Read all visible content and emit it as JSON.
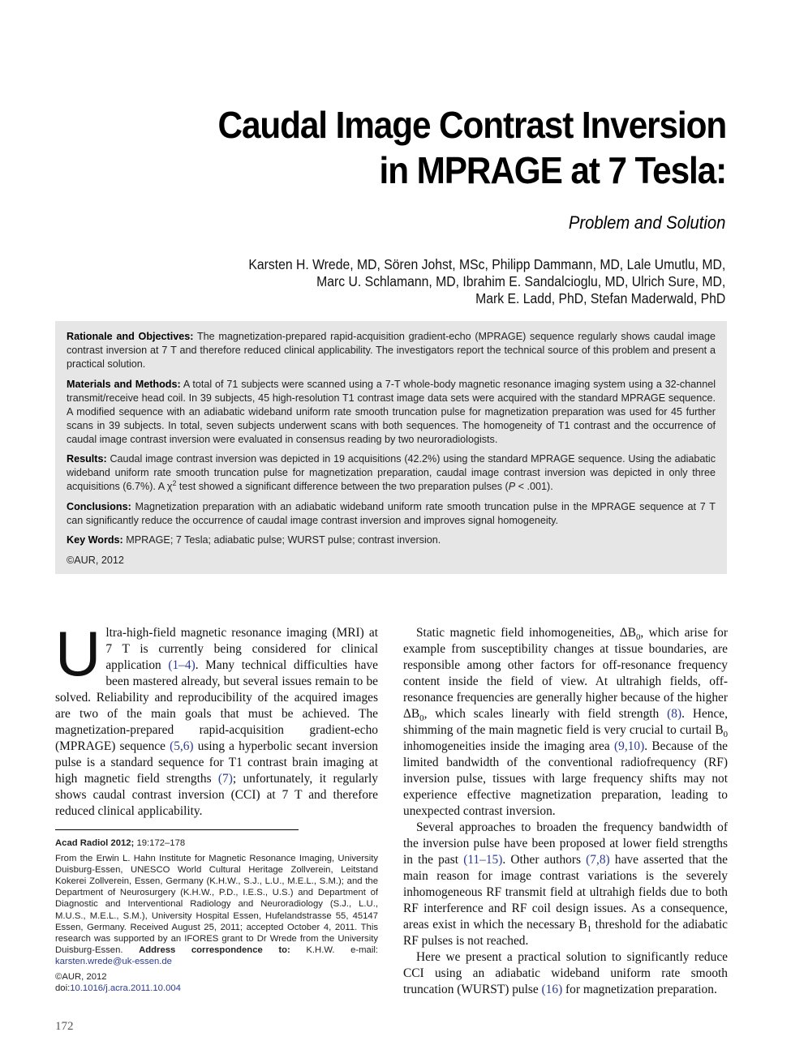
{
  "header": {
    "title_line1": "Caudal Image Contrast Inversion",
    "title_line2": "in MPRAGE at 7 Tesla:",
    "subtitle": "Problem and Solution",
    "authors": [
      "Karsten H. Wrede, MD, Sören Johst, MSc, Philipp Dammann, MD, Lale Umutlu, MD,",
      "Marc U. Schlamann, MD, Ibrahim E. Sandalcioglu, MD, Ulrich Sure, MD,",
      "Mark E. Ladd, PhD, Stefan Maderwald, PhD"
    ]
  },
  "abstract": {
    "rationale_label": "Rationale and Objectives:",
    "rationale_text": " The magnetization-prepared rapid-acquisition gradient-echo (MPRAGE) sequence regularly shows caudal image contrast inversion at 7 T and therefore reduced clinical applicability. The investigators report the technical source of this problem and present a practical solution.",
    "methods_label": "Materials and Methods:",
    "methods_text": " A total of 71 subjects were scanned using a 7-T whole-body magnetic resonance imaging system using a 32-channel transmit/receive head coil. In 39 subjects, 45 high-resolution T1 contrast image data sets were acquired with the standard MPRAGE sequence. A modified sequence with an adiabatic wideband uniform rate smooth truncation pulse for magnetization preparation was used for 45 further scans in 39 subjects. In total, seven subjects underwent scans with both sequences. The homogeneity of T1 contrast and the occurrence of caudal image contrast inversion were evaluated in consensus reading by two neuroradiologists.",
    "results_label": "Results:",
    "results_text_a": " Caudal image contrast inversion was depicted in 19 acquisitions (42.2%) using the standard MPRAGE sequence. Using the adiabatic wideband uniform rate smooth truncation pulse for magnetization preparation, caudal image contrast inversion was depicted in only three acquisitions (6.7%). A χ",
    "results_sup": "2",
    "results_text_b": " test showed a significant difference between the two preparation pulses (",
    "results_p": "P",
    "results_text_c": " < .001).",
    "conclusions_label": "Conclusions:",
    "conclusions_text": " Magnetization preparation with an adiabatic wideband uniform rate smooth truncation pulse in the MPRAGE sequence at 7 T can significantly reduce the occurrence of caudal image contrast inversion and improves signal homogeneity.",
    "keywords_label": "Key Words:",
    "keywords_text": " MPRAGE; 7 Tesla; adiabatic pulse; WURST pulse; contrast inversion.",
    "copyright": "©AUR, 2012"
  },
  "body_left": {
    "dropcap": "U",
    "p1_a": "ltra-high-field magnetic resonance imaging (MRI) at 7 T is currently being considered for clinical application ",
    "p1_ref1": "(1–4)",
    "p1_b": ". Many technical difficulties have been mastered already, but several issues remain to be solved. Reliability and reproducibility of the acquired images are two of the main goals that must be achieved. The magnetization-prepared rapid-acquisition gradient-echo (MPRAGE) sequence ",
    "p1_ref2": "(5,6)",
    "p1_c": " using a hyperbolic secant inversion pulse is a standard sequence for T1 contrast brain imaging at high magnetic field strengths ",
    "p1_ref3": "(7)",
    "p1_d": "; unfortunately, it regularly shows caudal contrast inversion (CCI) at 7 T and therefore reduced clinical applicability."
  },
  "body_right": {
    "p1_a": "Static magnetic field inhomogeneities, ΔB",
    "p1_sub1": "0",
    "p1_b": ", which arise for example from susceptibility changes at tissue boundaries, are responsible among other factors for off-resonance frequency content inside the field of view. At ultrahigh fields, off-resonance frequencies are generally higher because of the higher ΔB",
    "p1_sub2": "0",
    "p1_c": ", which scales linearly with field strength ",
    "p1_ref1": "(8)",
    "p1_d": ". Hence, shimming of the main magnetic field is very crucial to curtail B",
    "p1_sub3": "0",
    "p1_e": " inhomogeneities inside the imaging area ",
    "p1_ref2": "(9,10)",
    "p1_f": ". Because of the limited bandwidth of the conventional radiofrequency (RF) inversion pulse, tissues with large frequency shifts may not experience effective magnetization preparation, leading to unexpected contrast inversion.",
    "p2_a": "Several approaches to broaden the frequency bandwidth of the inversion pulse have been proposed at lower field strengths in the past ",
    "p2_ref1": "(11–15)",
    "p2_b": ". Other authors ",
    "p2_ref2": "(7,8)",
    "p2_c": " have asserted that the main reason for image contrast variations is the severely inhomogeneous RF transmit field at ultrahigh fields due to both RF interference and RF coil design issues. As a consequence, areas exist in which the necessary B",
    "p2_sub": "1",
    "p2_d": " threshold for the adiabatic RF pulses is not reached.",
    "p3_a": "Here we present a practical solution to significantly reduce CCI using an adiabatic wideband uniform rate smooth truncation (WURST) pulse ",
    "p3_ref": "(16)",
    "p3_b": " for magnetization preparation."
  },
  "footnote": {
    "journal_bold": "Acad Radiol 2012;",
    "journal_rest": " 19:172–178",
    "affil_a": "From the Erwin L. Hahn Institute for Magnetic Resonance Imaging, University Duisburg-Essen, UNESCO World Cultural Heritage Zollverein, Leitstand Kokerei Zollverein, Essen, Germany (K.H.W., S.J., L.U., M.E.L., S.M.); and the Department of Neurosurgery (K.H.W., P.D., I.E.S., U.S.) and Department of Diagnostic and Interventional Radiology and Neuroradiology (S.J., L.U., M.U.S., M.E.L., S.M.), University Hospital Essen, Hufelandstrasse 55, 45147 Essen, Germany. Received August 25, 2011; accepted October 4, 2011. This research was supported by an IFORES grant to Dr Wrede from the University Duisburg-Essen. ",
    "affil_bold": "Address correspondence to:",
    "affil_b": " K.H.W. e-mail: ",
    "email": "karsten.wrede@uk-essen.de",
    "copyright": "©AUR, 2012",
    "doi_label": "doi:",
    "doi": "10.1016/j.acra.2011.10.004"
  },
  "page_number": "172"
}
